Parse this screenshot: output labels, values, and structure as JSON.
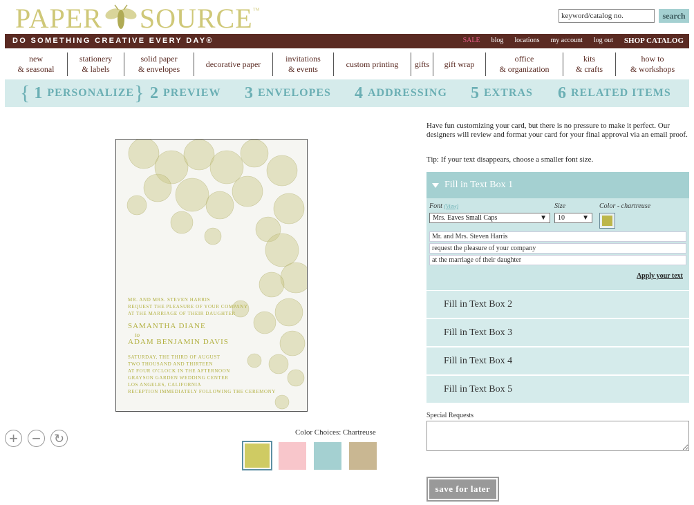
{
  "header": {
    "logo_left": "PAPER",
    "logo_right": "SOURCE",
    "logo_tm": "™",
    "search_placeholder": "keyword/catalog no.",
    "search_button": "search"
  },
  "topbar": {
    "tagline": "DO SOMETHING CREATIVE EVERY DAY®",
    "links": [
      "SALE",
      "blog",
      "locations",
      "my account",
      "log out",
      "SHOP CATALOG"
    ]
  },
  "nav": [
    {
      "l1": "new",
      "l2": "& seasonal"
    },
    {
      "l1": "stationery",
      "l2": "& labels"
    },
    {
      "l1": "solid paper",
      "l2": "& envelopes"
    },
    {
      "l1": "decorative paper",
      "l2": ""
    },
    {
      "l1": "invitations",
      "l2": "& events"
    },
    {
      "l1": "custom printing",
      "l2": ""
    },
    {
      "l1": "gifts",
      "l2": ""
    },
    {
      "l1": "gift wrap",
      "l2": ""
    },
    {
      "l1": "office",
      "l2": "& organization"
    },
    {
      "l1": "kits",
      "l2": "& crafts"
    },
    {
      "l1": "how to",
      "l2": "& workshops"
    }
  ],
  "steps": [
    {
      "n": "1",
      "label": "PERSONALIZE"
    },
    {
      "n": "2",
      "label": "PREVIEW"
    },
    {
      "n": "3",
      "label": "ENVELOPES"
    },
    {
      "n": "4",
      "label": "ADDRESSING"
    },
    {
      "n": "5",
      "label": "EXTRAS"
    },
    {
      "n": "6",
      "label": "RELATED ITEMS"
    }
  ],
  "card": {
    "l1": "Mr. and Mrs. Steven Harris",
    "l2": "request the pleasure of your company",
    "l3": "at the marriage of their daughter",
    "bride": "Samantha Diane",
    "to": "to",
    "groom": "Adam Benjamin Davis",
    "d1": "Saturday, the third of August",
    "d2": "two thousand and thirteen",
    "d3": "at four o'clock in the afternoon",
    "d4": "Grayson Garden Wedding Center",
    "d5": "Los Angeles, California",
    "d6": "reception immediately following the ceremony"
  },
  "colors": {
    "label": "Color Choices: Chartreuse",
    "swatches": [
      "#cfcb63",
      "#f8c6cb",
      "#a4d0d1",
      "#c9b792"
    ]
  },
  "panel": {
    "intro": "Have fun customizing your card, but there is no pressure to make it perfect. Our designers will review and format your card for your final approval via an email proof.",
    "tip": "Tip: If your text disappears, choose a smaller font size.",
    "box1_title": "Fill in Text Box 1",
    "font_label": "Font",
    "font_view": "(View)",
    "font_value": "Mrs. Eaves Small Caps",
    "size_label": "Size",
    "size_value": "10",
    "color_label": "Color - chartreuse",
    "lines": [
      "Mr. and Mrs. Steven Harris",
      "request the pleasure of your company",
      "at the marriage of their daughter"
    ],
    "apply": "Apply your text",
    "boxes": [
      "Fill in Text Box 2",
      "Fill in Text Box 3",
      "Fill in Text Box 4",
      "Fill in Text Box 5"
    ],
    "special_label": "Special Requests",
    "save": "save for later"
  }
}
